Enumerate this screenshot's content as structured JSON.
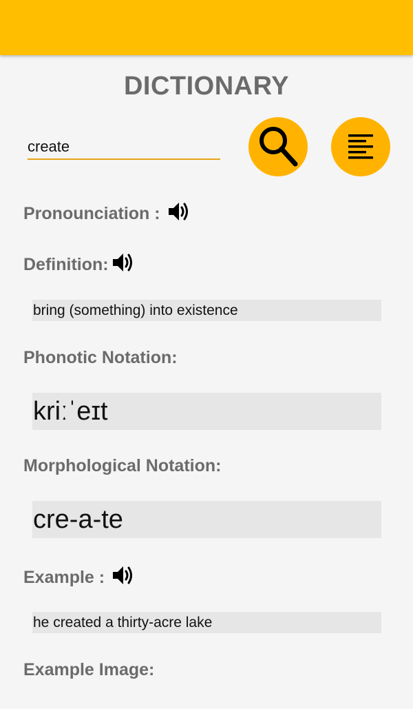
{
  "app": {
    "title": "DICTIONARY",
    "accent_color": "#ffbf00"
  },
  "search": {
    "value": "create",
    "button_icon": "search-icon",
    "menu_icon": "menu-lines-icon"
  },
  "pronunciation": {
    "label": "Pronounciation :",
    "icon": "speaker-icon"
  },
  "definition": {
    "label": "Definition:",
    "icon": "speaker-icon",
    "text": "bring (something) into existence"
  },
  "phonetic": {
    "label": "Phonotic Notation:",
    "text": "kriːˈeɪt"
  },
  "morphological": {
    "label": "Morphological Notation:",
    "text": "cre-a-te"
  },
  "example": {
    "label": "Example :",
    "icon": "speaker-icon",
    "text": "he created a thirty-acre lake"
  },
  "example_image": {
    "label": "Example Image:"
  }
}
